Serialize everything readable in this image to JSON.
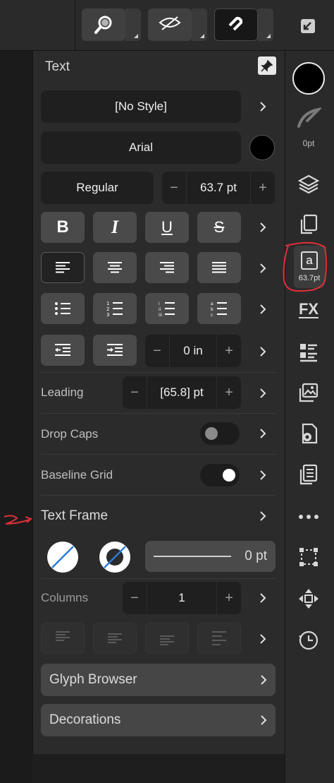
{
  "panel": {
    "title": "Text",
    "style_value": "[No Style]",
    "font_family": "Arial",
    "font_weight": "Regular",
    "font_size": "63.7 pt",
    "indent_value": "0 in",
    "leading_label": "Leading",
    "leading_value": "[65.8] pt",
    "dropcaps_label": "Drop Caps",
    "dropcaps_on": false,
    "baseline_label": "Baseline Grid",
    "baseline_on": true,
    "textframe_label": "Text Frame",
    "stroke_value": "0 pt",
    "columns_label": "Columns",
    "columns_value": "1",
    "glyph_label": "Glyph Browser",
    "decorations_label": "Decorations",
    "minus": "−",
    "plus": "+"
  },
  "sidebar": {
    "stroke_width": "0pt",
    "text_size": "63.7pt"
  },
  "colors": {
    "fill_swatch": "#000000",
    "font_color": "#000000",
    "annotation": "#e0303a"
  },
  "icons": [
    "zoom-icon",
    "view-icon",
    "snapping-icon",
    "expand-icon",
    "pin-icon",
    "layers-icon",
    "pages-icon",
    "text-style-icon",
    "fx-icon",
    "align-list-icon",
    "image-icon",
    "settings-doc-icon",
    "document-icon",
    "more-icon",
    "transform-icon",
    "move-icon",
    "history-icon"
  ]
}
